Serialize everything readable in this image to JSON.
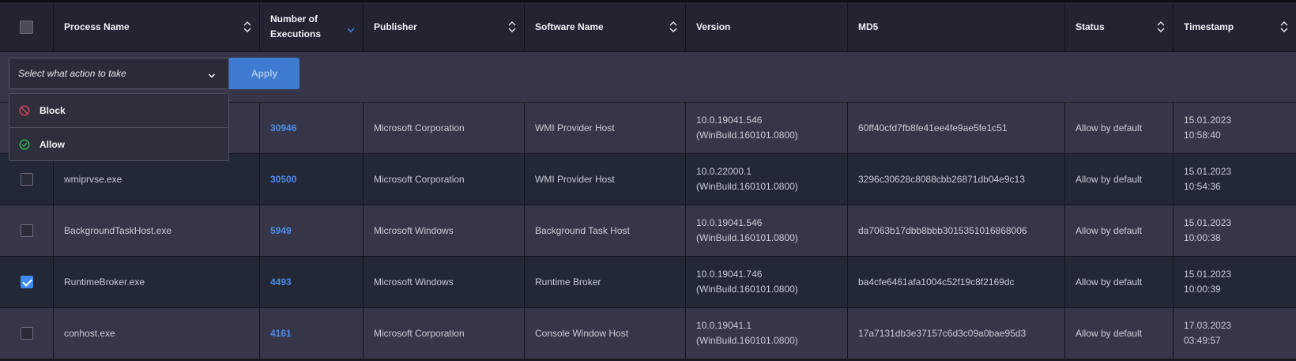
{
  "table": {
    "headers": {
      "process_name": "Process Name",
      "executions_line1": "Number of",
      "executions_line2": "Executions",
      "publisher": "Publisher",
      "software_name": "Software Name",
      "version": "Version",
      "md5": "MD5",
      "status": "Status",
      "timestamp": "Timestamp"
    },
    "rows": [
      {
        "checked": false,
        "process": "",
        "executions": "30946",
        "publisher": "Microsoft Corporation",
        "software": "WMI Provider Host",
        "version_line1": "10.0.19041.546",
        "version_line2": "(WinBuild.160101.0800)",
        "md5": "60ff40cfd7fb8fe41ee4fe9ae5fe1c51",
        "status": "Allow by default",
        "date": "15.01.2023",
        "time": "10:58:40"
      },
      {
        "checked": false,
        "process": "wmiprvse.exe",
        "executions": "30500",
        "publisher": "Microsoft Corporation",
        "software": "WMI Provider Host",
        "version_line1": "10.0.22000.1",
        "version_line2": "(WinBuild.160101.0800)",
        "md5": "3296c30628c8088cbb26871db04e9c13",
        "status": "Allow by default",
        "date": "15.01.2023",
        "time": "10:54:36"
      },
      {
        "checked": false,
        "process": "BackgroundTaskHost.exe",
        "executions": "5949",
        "publisher": "Microsoft Windows",
        "software": "Background Task Host",
        "version_line1": "10.0.19041.546",
        "version_line2": "(WinBuild.160101.0800)",
        "md5": "da7063b17dbb8bbb3015351016868006",
        "status": "Allow by default",
        "date": "15.01.2023",
        "time": "10:00:38"
      },
      {
        "checked": true,
        "process": "RuntimeBroker.exe",
        "executions": "4493",
        "publisher": "Microsoft Windows",
        "software": "Runtime Broker",
        "version_line1": "10.0.19041.746",
        "version_line2": "(WinBuild.160101.0800)",
        "md5": "ba4cfe6461afa1004c52f19c8f2169dc",
        "status": "Allow by default",
        "date": "15.01.2023",
        "time": "10:00:39"
      },
      {
        "checked": false,
        "process": "conhost.exe",
        "executions": "4161",
        "publisher": "Microsoft Corporation",
        "software": "Console Window Host",
        "version_line1": "10.0.19041.1",
        "version_line2": "(WinBuild.160101.0800)",
        "md5": "17a7131db3e37157c6d3c09a0bae95d3",
        "status": "Allow by default",
        "date": "17.03.2023",
        "time": "03:49:57"
      }
    ]
  },
  "action_bar": {
    "select_placeholder": "Select what action to take",
    "apply_label": "Apply",
    "options": [
      {
        "label": "Block",
        "icon": "block-icon"
      },
      {
        "label": "Allow",
        "icon": "check-circle-icon"
      }
    ]
  },
  "colors": {
    "link": "#4a8df0",
    "checkbox_checked": "#3d8bf5",
    "block_icon": "#e0445a",
    "allow_icon": "#2fbf5a",
    "apply_button": "#3e7bd0"
  }
}
